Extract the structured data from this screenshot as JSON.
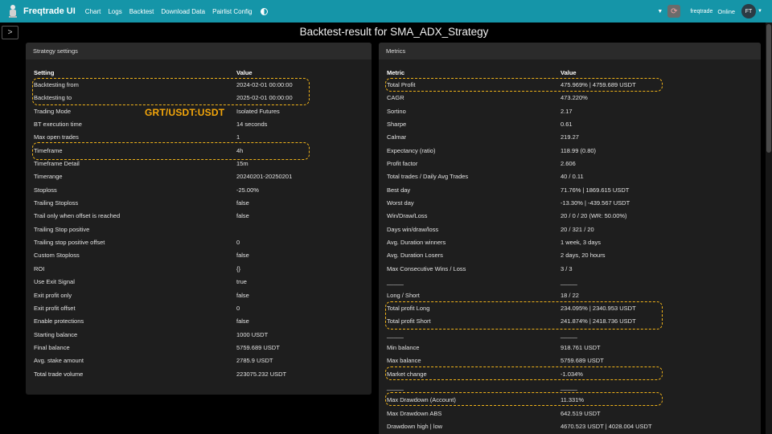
{
  "navbar": {
    "brand": "Freqtrade UI",
    "links": [
      "Chart",
      "Logs",
      "Backtest",
      "Download Data",
      "Pairlist Config"
    ],
    "bot_name": "freqtrade",
    "status": "Online",
    "avatar": "FT",
    "color": "#1595a8"
  },
  "sidebar_toggle": ">",
  "title": "Backtest-result for SMA_ADX_Strategy",
  "annotation": "GRT/USDT:USDT",
  "highlight_color": "#f0b31a",
  "strategy": {
    "header": "Strategy settings",
    "col_setting": "Setting",
    "col_value": "Value",
    "rows": [
      {
        "label": "Backtesting from",
        "value": "2024-02-01 00:00:00"
      },
      {
        "label": "Backtesting to",
        "value": "2025-02-01 00:00:00"
      },
      {
        "label": "Trading Mode",
        "value": "Isolated Futures"
      },
      {
        "label": "BT execution time",
        "value": "14 seconds"
      },
      {
        "label": "Max open trades",
        "value": "1"
      },
      {
        "label": "Timeframe",
        "value": "4h"
      },
      {
        "label": "Timeframe Detail",
        "value": "15m"
      },
      {
        "label": "Timerange",
        "value": "20240201-20250201"
      },
      {
        "label": "Stoploss",
        "value": "-25.00%"
      },
      {
        "label": "Trailing Stoploss",
        "value": "false"
      },
      {
        "label": "Trail only when offset is reached",
        "value": "false"
      },
      {
        "label": "Trailing Stop positive",
        "value": ""
      },
      {
        "label": "Trailing stop positive offset",
        "value": "0"
      },
      {
        "label": "Custom Stoploss",
        "value": "false"
      },
      {
        "label": "ROI",
        "value": "{}"
      },
      {
        "label": "Use Exit Signal",
        "value": "true"
      },
      {
        "label": "Exit profit only",
        "value": "false"
      },
      {
        "label": "Exit profit offset",
        "value": "0"
      },
      {
        "label": "Enable protections",
        "value": "false"
      },
      {
        "label": "Starting balance",
        "value": "1000 USDT"
      },
      {
        "label": "Final balance",
        "value": "5759.689 USDT"
      },
      {
        "label": "Avg. stake amount",
        "value": "2785.9 USDT"
      },
      {
        "label": "Total trade volume",
        "value": "223075.232 USDT"
      }
    ]
  },
  "metrics": {
    "header": "Metrics",
    "col_metric": "Metric",
    "col_value": "Value",
    "rows": [
      {
        "label": "Total Profit",
        "value": "475.969% | 4759.689 USDT"
      },
      {
        "label": "CAGR",
        "value": "473.220%"
      },
      {
        "label": "Sortino",
        "value": "2.17"
      },
      {
        "label": "Sharpe",
        "value": "0.61"
      },
      {
        "label": "Calmar",
        "value": "219.27"
      },
      {
        "label": "Expectancy (ratio)",
        "value": "118.99 (0.80)"
      },
      {
        "label": "Profit factor",
        "value": "2.606"
      },
      {
        "label": "Total trades / Daily Avg Trades",
        "value": "40 / 0.11"
      },
      {
        "label": "Best day",
        "value": "71.76% | 1869.615 USDT"
      },
      {
        "label": "Worst day",
        "value": "-13.30% | -439.567 USDT"
      },
      {
        "label": "Win/Draw/Loss",
        "value": "20 / 0 / 20 (WR: 50.00%)"
      },
      {
        "label": "Days win/draw/loss",
        "value": "20 / 321 / 20"
      },
      {
        "label": "Avg. Duration winners",
        "value": "1 week, 3 days"
      },
      {
        "label": "Avg. Duration Losers",
        "value": "2 days, 20 hours"
      },
      {
        "label": "Max Consecutive Wins / Loss",
        "value": "3 / 3"
      },
      {
        "label": "_____",
        "value": "_____"
      },
      {
        "label": "Long / Short",
        "value": "18 / 22"
      },
      {
        "label": "Total profit Long",
        "value": "234.095% | 2340.953 USDT"
      },
      {
        "label": "Total profit Short",
        "value": "241.874% | 2418.736 USDT"
      },
      {
        "label": "_____",
        "value": "_____"
      },
      {
        "label": "Min balance",
        "value": "918.761 USDT"
      },
      {
        "label": "Max balance",
        "value": "5759.689 USDT"
      },
      {
        "label": "Market change",
        "value": "-1.034%"
      },
      {
        "label": "_____",
        "value": "_____"
      },
      {
        "label": "Max Drawdown (Account)",
        "value": "11.331%"
      },
      {
        "label": "Max Drawdown ABS",
        "value": "642.519 USDT"
      },
      {
        "label": "Drawdown high | low",
        "value": "4670.523 USDT | 4028.004 USDT"
      }
    ]
  }
}
